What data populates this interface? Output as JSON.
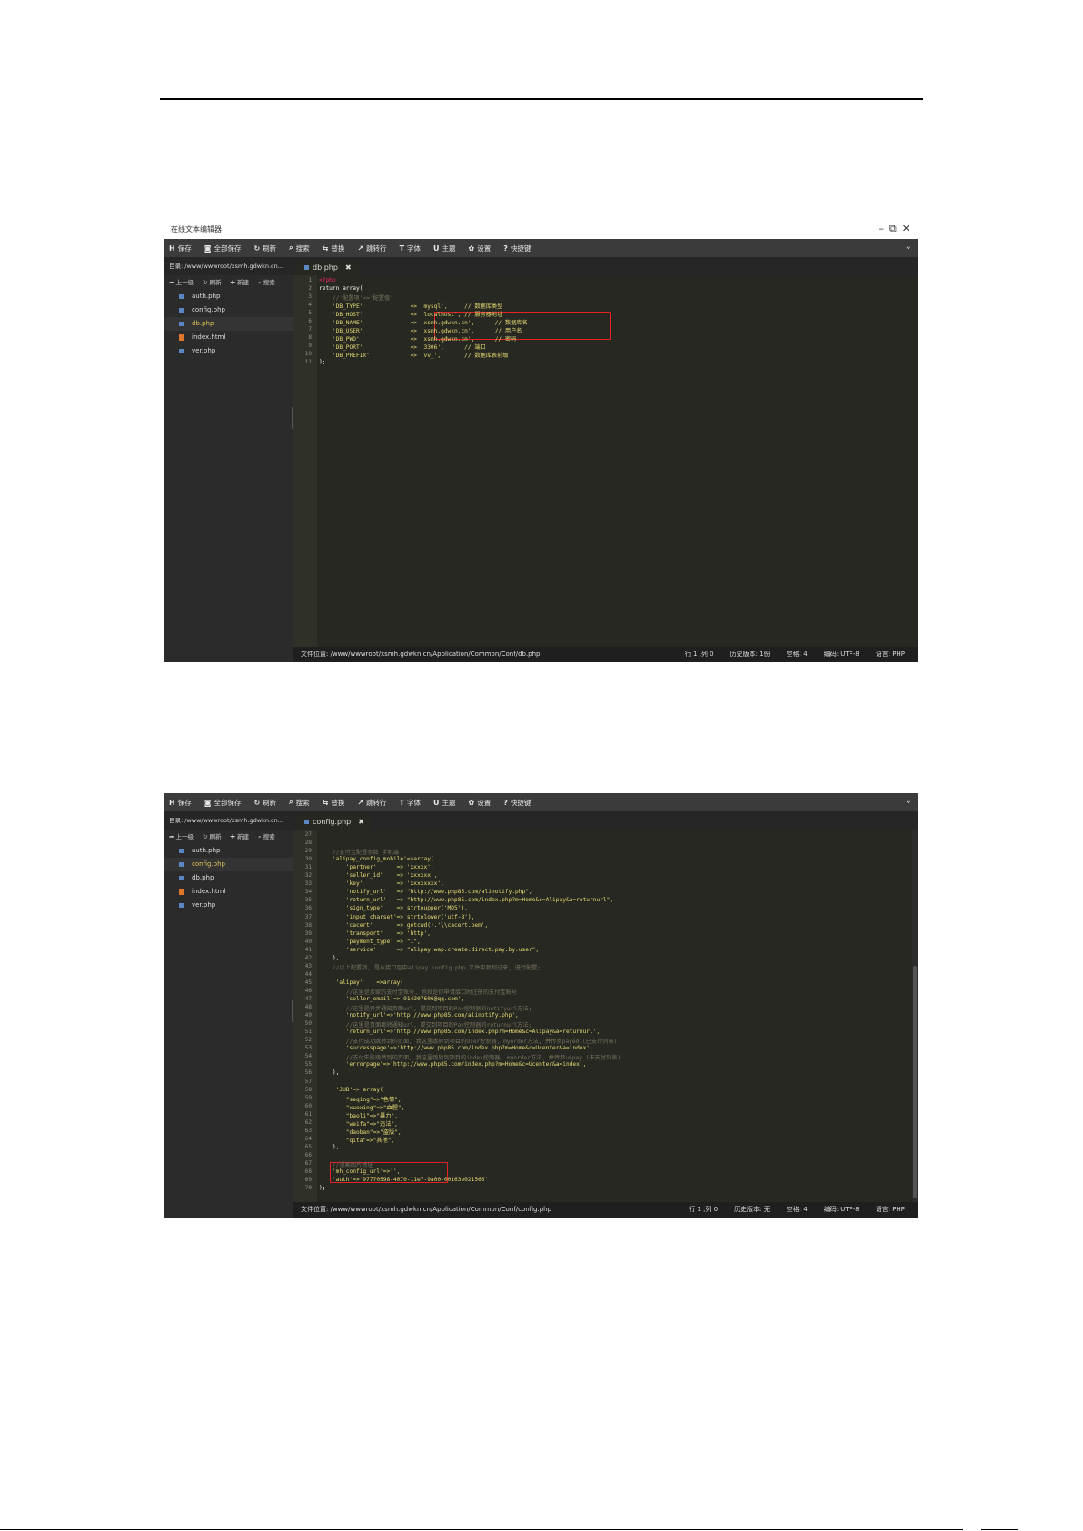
{
  "screenshot1": {
    "window_title": "在线文本编辑器",
    "toolbar": [
      "保存",
      "全部保存",
      "刷新",
      "搜索",
      "替换",
      "跳转行",
      "字体",
      "主题",
      "设置",
      "快捷键"
    ],
    "toolbar_icons": [
      "save-icon",
      "save-all-icon",
      "refresh-icon",
      "search-icon",
      "replace-icon",
      "goto-line-icon",
      "font-icon",
      "theme-icon",
      "settings-icon",
      "shortcut-icon"
    ],
    "directory": "目录: /www/wwwroot/xsmh.gdwkn.cn...",
    "side_tools": [
      "上一级",
      "刷新",
      "新建",
      "搜索"
    ],
    "files": [
      "auth.php",
      "config.php",
      "db.php",
      "index.html",
      "ver.php"
    ],
    "active_tab": "db.php",
    "code": [
      {
        "n": "1",
        "t": "<?php",
        "c": "kw"
      },
      {
        "n": "2",
        "t": "return array(",
        "c": ""
      },
      {
        "n": "3",
        "t": "    //'配置项'=>'配置值'",
        "c": "cm"
      },
      {
        "n": "4",
        "t": "    'DB_TYPE'              => 'mysql',     // 数据库类型",
        "c": "st"
      },
      {
        "n": "5",
        "t": "    'DB_HOST'              => 'localhost', // 服务器地址",
        "c": "st"
      },
      {
        "n": "6",
        "t": "    'DB_NAME'              => 'xsmh.gdwkn.cn',      // 数据库名",
        "c": "st"
      },
      {
        "n": "7",
        "t": "    'DB_USER'              => 'xsmh.gdwkn.cn',      // 用户名",
        "c": "st"
      },
      {
        "n": "8",
        "t": "    'DB_PWD'               => 'xsmh.gdwkn.cn',      // 密码",
        "c": "st"
      },
      {
        "n": "9",
        "t": "    'DB_PORT'              => '3306',      // 端口",
        "c": "st"
      },
      {
        "n": "10",
        "t": "    'DB_PREFIX'            => 'vv_',       // 数据库表前缀",
        "c": "st"
      },
      {
        "n": "11",
        "t": ");",
        "c": ""
      }
    ],
    "status": {
      "path": "文件位置: /www/wwwroot/xsmh.gdwkn.cn/Application/Common/Conf/db.php",
      "pos": "行 1 ,列 0",
      "history": "历史版本: 1份",
      "indent": "空格: 4",
      "encoding": "编码: UTF-8",
      "lang": "语言: PHP"
    }
  },
  "screenshot2": {
    "toolbar": [
      "保存",
      "全部保存",
      "刷新",
      "搜索",
      "替换",
      "跳转行",
      "字体",
      "主题",
      "设置",
      "快捷键"
    ],
    "toolbar_icons": [
      "save-icon",
      "save-all-icon",
      "refresh-icon",
      "search-icon",
      "replace-icon",
      "goto-line-icon",
      "font-icon",
      "theme-icon",
      "settings-icon",
      "shortcut-icon"
    ],
    "directory": "目录: /www/wwwroot/xsmh.gdwkn.cn...",
    "side_tools": [
      "上一级",
      "刷新",
      "新建",
      "搜索"
    ],
    "files": [
      "auth.php",
      "config.php",
      "db.php",
      "index.html",
      "ver.php"
    ],
    "active_tab": "config.php",
    "code": [
      {
        "n": "27",
        "t": "",
        "c": ""
      },
      {
        "n": "28",
        "t": "",
        "c": ""
      },
      {
        "n": "29",
        "t": "    //支付宝配置参数 手机端",
        "c": "cm"
      },
      {
        "n": "30",
        "t": "    'alipay_config_mobile'=>array(",
        "c": "st"
      },
      {
        "n": "31",
        "t": "        'partner'      => 'xxxxx',",
        "c": "st"
      },
      {
        "n": "32",
        "t": "        'seller_id'    => 'xxxxxx',",
        "c": "st"
      },
      {
        "n": "33",
        "t": "        'key'          => 'xxxxxxxx',",
        "c": "st"
      },
      {
        "n": "34",
        "t": "        'notify_url'   => \"http://www.php85.com/alinotify.php\",",
        "c": "st"
      },
      {
        "n": "35",
        "t": "        'return_url'   => \"http://www.php85.com/index.php?m=Home&c=Alipay&a=returnurl\",",
        "c": "st"
      },
      {
        "n": "36",
        "t": "        'sign_type'    => strtoupper('MD5'),",
        "c": "st"
      },
      {
        "n": "37",
        "t": "        'input_charset'=> strtolower('utf-8'),",
        "c": "st"
      },
      {
        "n": "38",
        "t": "        'cacert'       => getcwd().'\\\\cacert.pem',",
        "c": "st"
      },
      {
        "n": "39",
        "t": "        'transport'    => 'http',",
        "c": "st"
      },
      {
        "n": "40",
        "t": "        'payment_type' => \"1\",",
        "c": "st"
      },
      {
        "n": "41",
        "t": "        'service'      => \"alipay.wap.create.direct.pay.by.user\",",
        "c": "st"
      },
      {
        "n": "42",
        "t": "    ),",
        "c": ""
      },
      {
        "n": "43",
        "t": "    //以上配置项, 是从接口包中alipay.config.php 文件中复制过来, 进行配置;",
        "c": "cm"
      },
      {
        "n": "44",
        "t": "",
        "c": ""
      },
      {
        "n": "45",
        "t": "     'alipay'    =>array(",
        "c": "st"
      },
      {
        "n": "46",
        "t": "        //这里是卖家的支付宝账号, 也就是你申请接口时注册的支付宝账号",
        "c": "cm"
      },
      {
        "n": "47",
        "t": "        'seller_email'=>'914207606@qq.com',",
        "c": "st"
      },
      {
        "n": "48",
        "t": "        //这里是异步通知页面url, 提交到项目的Pay控制器的notifyurl方法;",
        "c": "cm"
      },
      {
        "n": "49",
        "t": "        'notify_url'=>'http://www.php85.com/alinotify.php',",
        "c": "st"
      },
      {
        "n": "50",
        "t": "        //这里是页面跳转通知url, 提交到项目的Pay控制器的returnurl方法;",
        "c": "cm"
      },
      {
        "n": "51",
        "t": "        'return_url'=>'http://www.php85.com/index.php?m=Home&c=Alipay&a=returnurl',",
        "c": "st"
      },
      {
        "n": "52",
        "t": "        //支付成功跳转到的页面, 我这里跳转到项目的User控制器, myorder方法, 并传参payed (已支付列表)",
        "c": "cm"
      },
      {
        "n": "53",
        "t": "        'successpage'=>'http://www.php85.com/index.php?m=Home&c=Ucenter&a=index',",
        "c": "st"
      },
      {
        "n": "54",
        "t": "        //支付失败跳转到的页面, 我这里跳转到项目的index控制器, myorder方法, 并传参unpay (未支付列表)",
        "c": "cm"
      },
      {
        "n": "55",
        "t": "        'errorpage'=>'http://www.php85.com/index.php?m=Home&c=Ucenter&a=index',",
        "c": "st"
      },
      {
        "n": "56",
        "t": "    ),",
        "c": ""
      },
      {
        "n": "57",
        "t": "",
        "c": ""
      },
      {
        "n": "58",
        "t": "     'JUB'=> array(",
        "c": "st"
      },
      {
        "n": "59",
        "t": "        \"seqing\"=>\"色情\",",
        "c": "st"
      },
      {
        "n": "60",
        "t": "        \"xuexing\"=>\"血腥\",",
        "c": "st"
      },
      {
        "n": "61",
        "t": "        \"baoli\"=>\"暴力\",",
        "c": "st"
      },
      {
        "n": "62",
        "t": "        \"weifa\"=>\"违法\",",
        "c": "st"
      },
      {
        "n": "63",
        "t": "        \"daoban\"=>\"盗版\",",
        "c": "st"
      },
      {
        "n": "64",
        "t": "        \"qita\"=>\"其他\",",
        "c": "st"
      },
      {
        "n": "65",
        "t": "    ),",
        "c": ""
      },
      {
        "n": "66",
        "t": "",
        "c": ""
      },
      {
        "n": "67",
        "t": "    //漫画图片地址",
        "c": "cm"
      },
      {
        "n": "68",
        "t": "    'mh_config_url'=>'',",
        "c": "st"
      },
      {
        "n": "69",
        "t": "    'auth'=>'97770598-4070-11e7-9a00-00163e021565'",
        "c": "st"
      },
      {
        "n": "70",
        "t": ");",
        "c": ""
      }
    ],
    "status": {
      "path": "文件位置: /www/wwwroot/xsmh.gdwkn.cn/Application/Common/Conf/config.php",
      "pos": "行 1 ,列 0",
      "history": "历史版本: 无",
      "indent": "空格: 4",
      "encoding": "编码: UTF-8",
      "lang": "语言: PHP"
    }
  },
  "colors": {
    "highlight": "#e02424",
    "editor_bg": "#272822",
    "toolbar_bg": "#3b3b3b"
  }
}
